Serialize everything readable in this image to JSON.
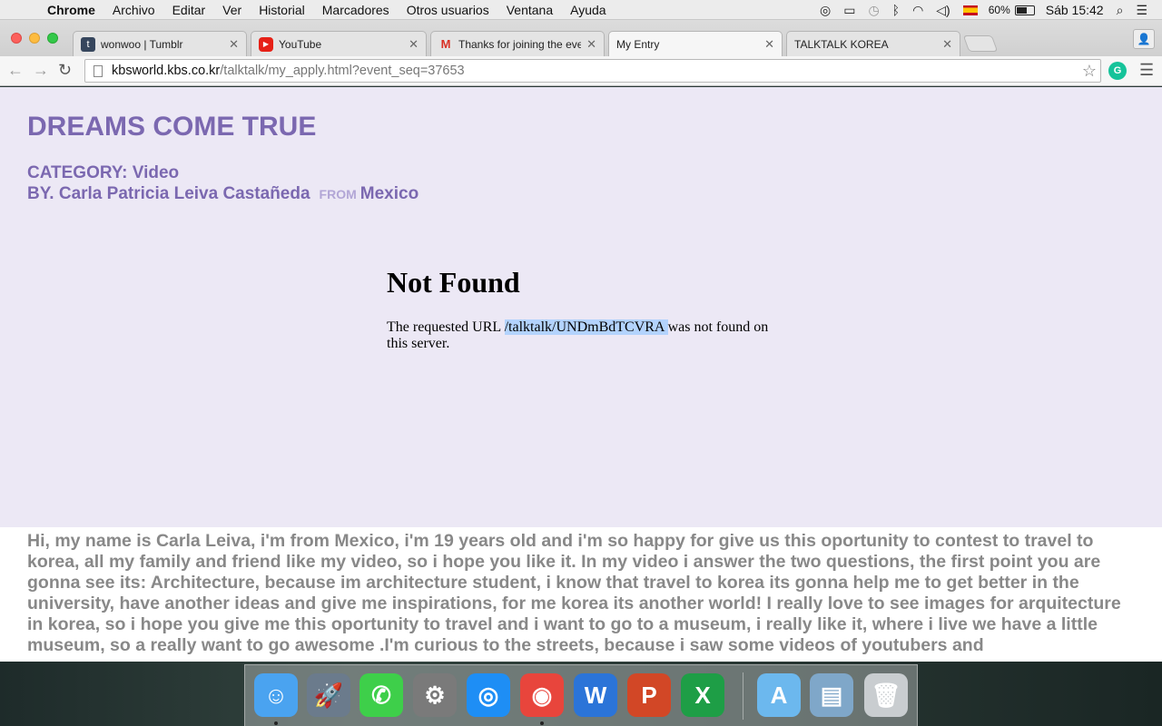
{
  "menubar": {
    "apple": "",
    "app_name": "Chrome",
    "menus": [
      "Archivo",
      "Editar",
      "Ver",
      "Historial",
      "Marcadores",
      "Otros usuarios",
      "Ventana",
      "Ayuda"
    ],
    "battery_percent": "60%",
    "battery_level": 0.6,
    "clock": "Sáb 15:42"
  },
  "tabs": [
    {
      "title": "wonwoo | Tumblr",
      "icon": "tumblr-icon",
      "fav": "t"
    },
    {
      "title": "YouTube",
      "icon": "youtube-icon",
      "fav": "▶"
    },
    {
      "title": "Thanks for joining the even",
      "icon": "gmail-icon",
      "fav": "M"
    },
    {
      "title": "My Entry",
      "icon": "page-icon",
      "fav": ""
    },
    {
      "title": "TALKTALK KOREA",
      "icon": "page-icon",
      "fav": ""
    }
  ],
  "tab_close": "✕",
  "address_bar": {
    "host": "kbsworld.kbs.co.kr",
    "path": "/talktalk/my_apply.html?event_seq=37653"
  },
  "toolbar": {
    "back": "←",
    "forward": "→",
    "reload": "↻",
    "star": "☆",
    "menu": "☰",
    "grammarly": "G"
  },
  "entry": {
    "title": "DREAMS COME TRUE",
    "category_line": "CATEGORY: Video",
    "by_prefix": "BY. Carla Patricia Leiva Castañeda",
    "from_label": "FROM",
    "country": "Mexico"
  },
  "error": {
    "heading": "Not Found",
    "text_before": "The requested URL ",
    "url": "/talktalk/UNDmBdTCVRA ",
    "text_after": "was not found on this server."
  },
  "description": "Hi, my name is Carla Leiva, i'm from Mexico, i'm 19 years old and i'm so happy for give us this oportunity to contest to travel to korea, all my family and friend like my video, so i hope you like it. In my video i answer the two questions, the first point you are gonna see its: Architecture, because im architecture student, i know that travel to korea its gonna help me to get better in the university, have another ideas and give me inspirations, for me korea its another world! I really love to see images for arquitecture in korea, so i hope you give me this oportunity to travel and i want to go to a museum, i really like it, where i live we have a little museum, so a really want to go awesome .I'm curious to the streets, because i saw some videos of youtubers and",
  "dock": {
    "apps": [
      {
        "name": "finder-icon",
        "color": "#4aa3f0",
        "glyph": "☺",
        "running": true
      },
      {
        "name": "launchpad-icon",
        "color": "#6b7b8c",
        "glyph": "🚀",
        "running": false
      },
      {
        "name": "facetime-icon",
        "color": "#3ecf4a",
        "glyph": "✆",
        "running": false
      },
      {
        "name": "system-preferences-icon",
        "color": "#7a7a7a",
        "glyph": "⚙",
        "running": false
      },
      {
        "name": "safari-icon",
        "color": "#1e8ef5",
        "glyph": "◎",
        "running": false
      },
      {
        "name": "chrome-icon",
        "color": "#e8453c",
        "glyph": "◉",
        "running": true
      },
      {
        "name": "word-icon",
        "color": "#2b74d8",
        "glyph": "W",
        "running": false
      },
      {
        "name": "powerpoint-icon",
        "color": "#d24726",
        "glyph": "P",
        "running": false
      },
      {
        "name": "excel-icon",
        "color": "#1e9e46",
        "glyph": "X",
        "running": false
      }
    ],
    "folders": [
      {
        "name": "applications-folder-icon",
        "color": "#6cb8ee",
        "glyph": "A"
      },
      {
        "name": "documents-folder-icon",
        "color": "#7fa7c9",
        "glyph": "▤"
      },
      {
        "name": "trash-icon",
        "color": "#c9cdd0",
        "glyph": "🗑"
      }
    ]
  }
}
